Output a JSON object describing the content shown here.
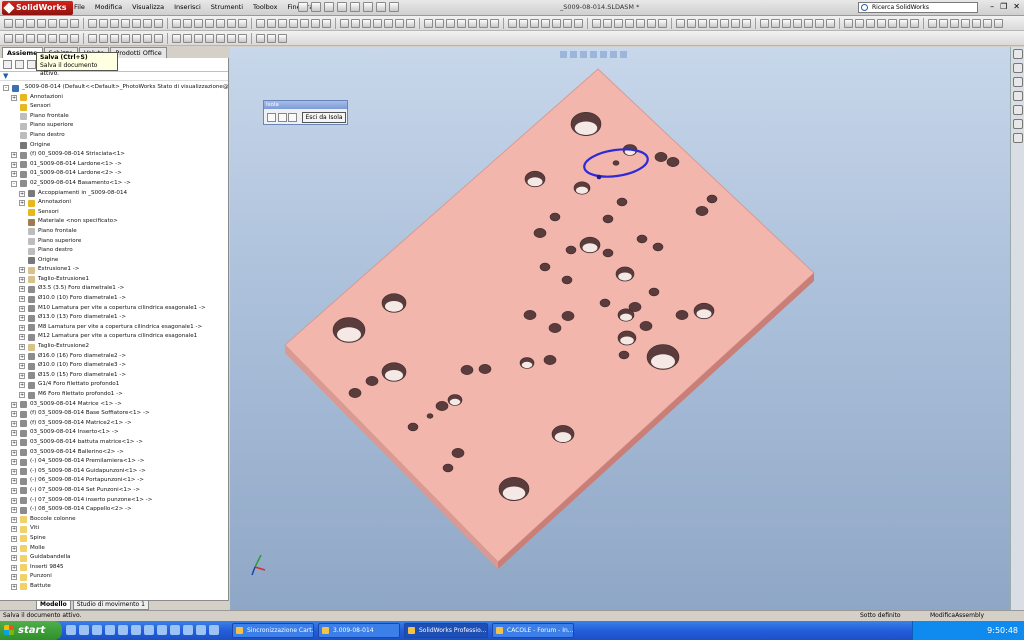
{
  "app": {
    "brand": "SolidWorks",
    "document_title": "_S009-08-014.SLDASM *"
  },
  "menu": [
    "File",
    "Modifica",
    "Visualizza",
    "Inserisci",
    "Strumenti",
    "Toolbox",
    "Finestra"
  ],
  "search": {
    "placeholder": "Ricerca SolidWorks"
  },
  "tabs": [
    "Assieme",
    "Schizzo",
    "Valuta",
    "Prodotti Office"
  ],
  "tooltip": {
    "title": "Salva   (Ctrl+S)",
    "text": "Salva il documento attivo."
  },
  "tree": [
    {
      "d": 0,
      "t": "_S009-08-014  (Default<<Default>_PhotoWorks Stato di visualizzazione@>)",
      "exp": "-",
      "ico": "#3c6fb5"
    },
    {
      "d": 1,
      "t": "Annotazioni",
      "exp": "+",
      "ico": "#e7b620"
    },
    {
      "d": 1,
      "t": "Sensori",
      "exp": "",
      "ico": "#e7b620"
    },
    {
      "d": 1,
      "t": "Piano frontale",
      "exp": "",
      "ico": "#bdbdbd"
    },
    {
      "d": 1,
      "t": "Piano superiore",
      "exp": "",
      "ico": "#bdbdbd"
    },
    {
      "d": 1,
      "t": "Piano destro",
      "exp": "",
      "ico": "#bdbdbd"
    },
    {
      "d": 1,
      "t": "Origine",
      "exp": "",
      "ico": "#777777"
    },
    {
      "d": 1,
      "t": "(f) 00_S009-08-014 Strisciata<1>",
      "exp": "+",
      "ico": "#8c8c8c"
    },
    {
      "d": 1,
      "t": "01_S009-08-014 Lardone<1> ->",
      "exp": "+",
      "ico": "#8c8c8c"
    },
    {
      "d": 1,
      "t": "01_S009-08-014 Lardone<2> ->",
      "exp": "+",
      "ico": "#8c8c8c"
    },
    {
      "d": 1,
      "t": "02_S009-08-014 Basamento<1> ->",
      "exp": "-",
      "ico": "#8c8c8c"
    },
    {
      "d": 2,
      "t": "Accoppiamenti in _S009-08-014",
      "exp": "+",
      "ico": "#7a7a7a"
    },
    {
      "d": 2,
      "t": "Annotazioni",
      "exp": "+",
      "ico": "#e7b620"
    },
    {
      "d": 2,
      "t": "Sensori",
      "exp": "",
      "ico": "#e7b620"
    },
    {
      "d": 2,
      "t": "Materiale <non specificato>",
      "exp": "",
      "ico": "#a07a52"
    },
    {
      "d": 2,
      "t": "Piano frontale",
      "exp": "",
      "ico": "#bdbdbd"
    },
    {
      "d": 2,
      "t": "Piano superiore",
      "exp": "",
      "ico": "#bdbdbd"
    },
    {
      "d": 2,
      "t": "Piano destro",
      "exp": "",
      "ico": "#bdbdbd"
    },
    {
      "d": 2,
      "t": "Origine",
      "exp": "",
      "ico": "#777777"
    },
    {
      "d": 2,
      "t": "Estrusione1 ->",
      "exp": "+",
      "ico": "#d8c28a"
    },
    {
      "d": 2,
      "t": "Taglio-Estrusione1",
      "exp": "+",
      "ico": "#d8c28a"
    },
    {
      "d": 2,
      "t": "Ø3.5 (3.5) Foro diametrale1 ->",
      "exp": "+",
      "ico": "#8c8c8c"
    },
    {
      "d": 2,
      "t": "Ø10.0 (10) Foro diametrale1 ->",
      "exp": "+",
      "ico": "#8c8c8c"
    },
    {
      "d": 2,
      "t": "M10 Lamatura per vite a copertura cilindrica esagonale1 ->",
      "exp": "+",
      "ico": "#8c8c8c"
    },
    {
      "d": 2,
      "t": "Ø13.0 (13) Foro diametrale1 ->",
      "exp": "+",
      "ico": "#8c8c8c"
    },
    {
      "d": 2,
      "t": "M8 Lamatura per vite a copertura cilindrica esagonale1 ->",
      "exp": "+",
      "ico": "#8c8c8c"
    },
    {
      "d": 2,
      "t": "M12 Lamatura per vite a copertura cilindrica esagonale1",
      "exp": "+",
      "ico": "#8c8c8c"
    },
    {
      "d": 2,
      "t": "Taglio-Estrusione2",
      "exp": "+",
      "ico": "#d8c28a"
    },
    {
      "d": 2,
      "t": "Ø16.0 (16) Foro diametrale2 ->",
      "exp": "+",
      "ico": "#8c8c8c"
    },
    {
      "d": 2,
      "t": "Ø10.0 (10) Foro diametrale3 ->",
      "exp": "+",
      "ico": "#8c8c8c"
    },
    {
      "d": 2,
      "t": "Ø15.0 (15) Foro diametrale1 ->",
      "exp": "+",
      "ico": "#8c8c8c"
    },
    {
      "d": 2,
      "t": "G1/4 Foro filettato profondo1",
      "exp": "+",
      "ico": "#8c8c8c"
    },
    {
      "d": 2,
      "t": "M6 Foro filettato profondo1 ->",
      "exp": "+",
      "ico": "#8c8c8c"
    },
    {
      "d": 1,
      "t": "03_S009-08-014 Matrice <1> ->",
      "exp": "+",
      "ico": "#8c8c8c"
    },
    {
      "d": 1,
      "t": "(f) 03_S009-08-014 Base Soffiatore<1> ->",
      "exp": "+",
      "ico": "#8c8c8c"
    },
    {
      "d": 1,
      "t": "(f) 03_S009-08-014 Matrice2<1> ->",
      "exp": "+",
      "ico": "#8c8c8c"
    },
    {
      "d": 1,
      "t": "03_S009-08-014 Inserto<1> ->",
      "exp": "+",
      "ico": "#8c8c8c"
    },
    {
      "d": 1,
      "t": "03_S009-08-014 battuta matrice<1> ->",
      "exp": "+",
      "ico": "#8c8c8c"
    },
    {
      "d": 1,
      "t": "03_S009-08-014 Ballerino<2> ->",
      "exp": "+",
      "ico": "#8c8c8c"
    },
    {
      "d": 1,
      "t": "(-) 04_S009-08-014  Premilamiera<1> ->",
      "exp": "+",
      "ico": "#8c8c8c"
    },
    {
      "d": 1,
      "t": "(-) 05_S009-08-014 Guidapunzoni<1> ->",
      "exp": "+",
      "ico": "#8c8c8c"
    },
    {
      "d": 1,
      "t": "(-) 06_S009-08-014  Portapunzoni<1> ->",
      "exp": "+",
      "ico": "#8c8c8c"
    },
    {
      "d": 1,
      "t": "(-) 07_S009-08-014 Set Punzoni<1> ->",
      "exp": "+",
      "ico": "#8c8c8c"
    },
    {
      "d": 1,
      "t": "(-) 07_S009-08-014 inserto punzone<1> ->",
      "exp": "+",
      "ico": "#8c8c8c"
    },
    {
      "d": 1,
      "t": "(-) 08_S009-08-014 Cappello<2> ->",
      "exp": "+",
      "ico": "#8c8c8c"
    },
    {
      "d": 1,
      "t": "Boccole colonne",
      "exp": "+",
      "ico": "#f1d26a"
    },
    {
      "d": 1,
      "t": "Viti",
      "exp": "+",
      "ico": "#f1d26a"
    },
    {
      "d": 1,
      "t": "Spine",
      "exp": "+",
      "ico": "#f1d26a"
    },
    {
      "d": 1,
      "t": "Molle",
      "exp": "+",
      "ico": "#f1d26a"
    },
    {
      "d": 1,
      "t": "Guidabandella",
      "exp": "+",
      "ico": "#f1d26a"
    },
    {
      "d": 1,
      "t": "Inserti 9845",
      "exp": "+",
      "ico": "#f1d26a"
    },
    {
      "d": 1,
      "t": "Punzoni",
      "exp": "+",
      "ico": "#f1d26a"
    },
    {
      "d": 1,
      "t": "Battute",
      "exp": "+",
      "ico": "#f1d26a"
    }
  ],
  "bottom_tabs": [
    "Modello",
    "Studio di movimento 1"
  ],
  "isola": {
    "title": "Isola",
    "button": "Esci da Isola"
  },
  "status": {
    "left": "Salva il documento attivo.",
    "definition": "Sotto definito",
    "mode": "ModificaAssembly"
  },
  "taskbar": {
    "start": "start",
    "tasks": [
      "Sincronizzazione Cart...",
      "3.009-08-014",
      "SolidWorks Professio...",
      "CACOLE - Forum - In..."
    ],
    "clock": "9:50:48"
  },
  "colors": {
    "part": "#f2b6ad",
    "part_side": "#c97f78",
    "part_edge": "#d89a92",
    "selection": "#2d2ad6"
  }
}
